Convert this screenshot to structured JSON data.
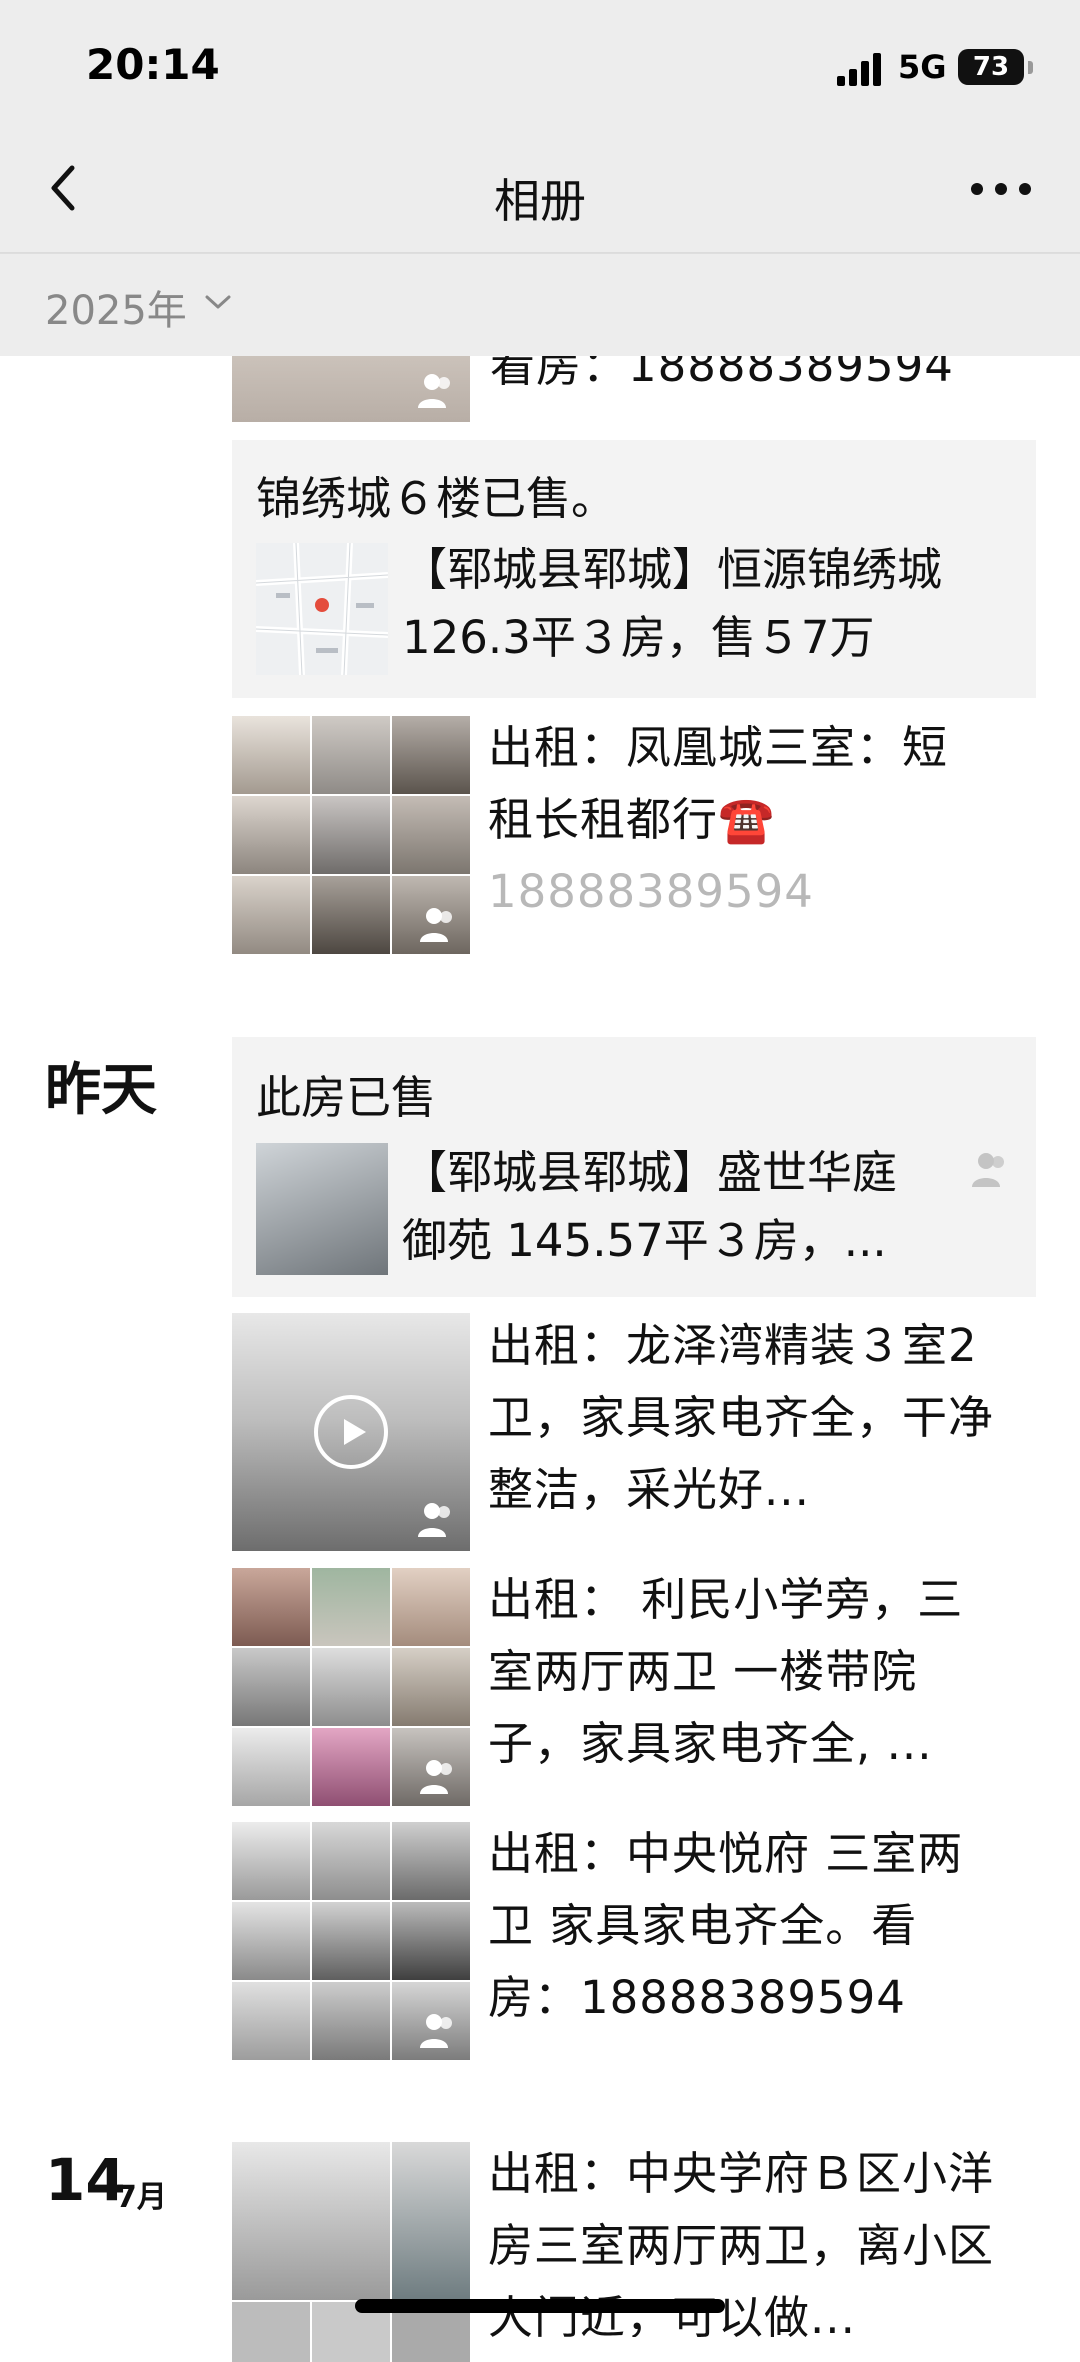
{
  "status_bar": {
    "time": "20:14",
    "network": "5G",
    "battery": "73"
  },
  "nav": {
    "title": "相册",
    "back_icon": "chevron-left-icon",
    "more_icon": "more-horizontal-icon"
  },
  "year_filter": {
    "label": "2025年"
  },
  "posts": [
    {
      "partial_text": "看房：18888389594"
    },
    {
      "caption": "锦绣城６楼已售。",
      "share_title": "【郓城县郓城】恒源锦绣城126.3平３房，售５7万"
    },
    {
      "text_line1": "出租：凤凰城三室：短",
      "text_line2": "租长租都行☎️",
      "text_line3": "18888389594"
    }
  ],
  "yesterday": {
    "label": "昨天",
    "posts": [
      {
        "caption": "此房已售",
        "share_title": "【郓城县郓城】盛世华庭御苑 145.57平３房，..."
      },
      {
        "text": "出租：龙泽湾精装３室2卫，家具家电齐全，干净整洁，采光好..."
      },
      {
        "text": "出租：  利民小学旁，三室两厅两卫 一楼带院子，家具家电齐全, ..."
      },
      {
        "text": "出租：中央悦府 三室两卫 家具家电齐全。看房：18888389594"
      }
    ]
  },
  "day14": {
    "day": "14",
    "month": "7月",
    "text": "出租：中央学府Ｂ区小洋房三室两厅两卫，离小区大门近，可以做..."
  },
  "colors": {
    "background": "#ffffff",
    "header_bg": "#ededed",
    "card_bg": "#f3f3f3",
    "muted_text": "#888888"
  }
}
